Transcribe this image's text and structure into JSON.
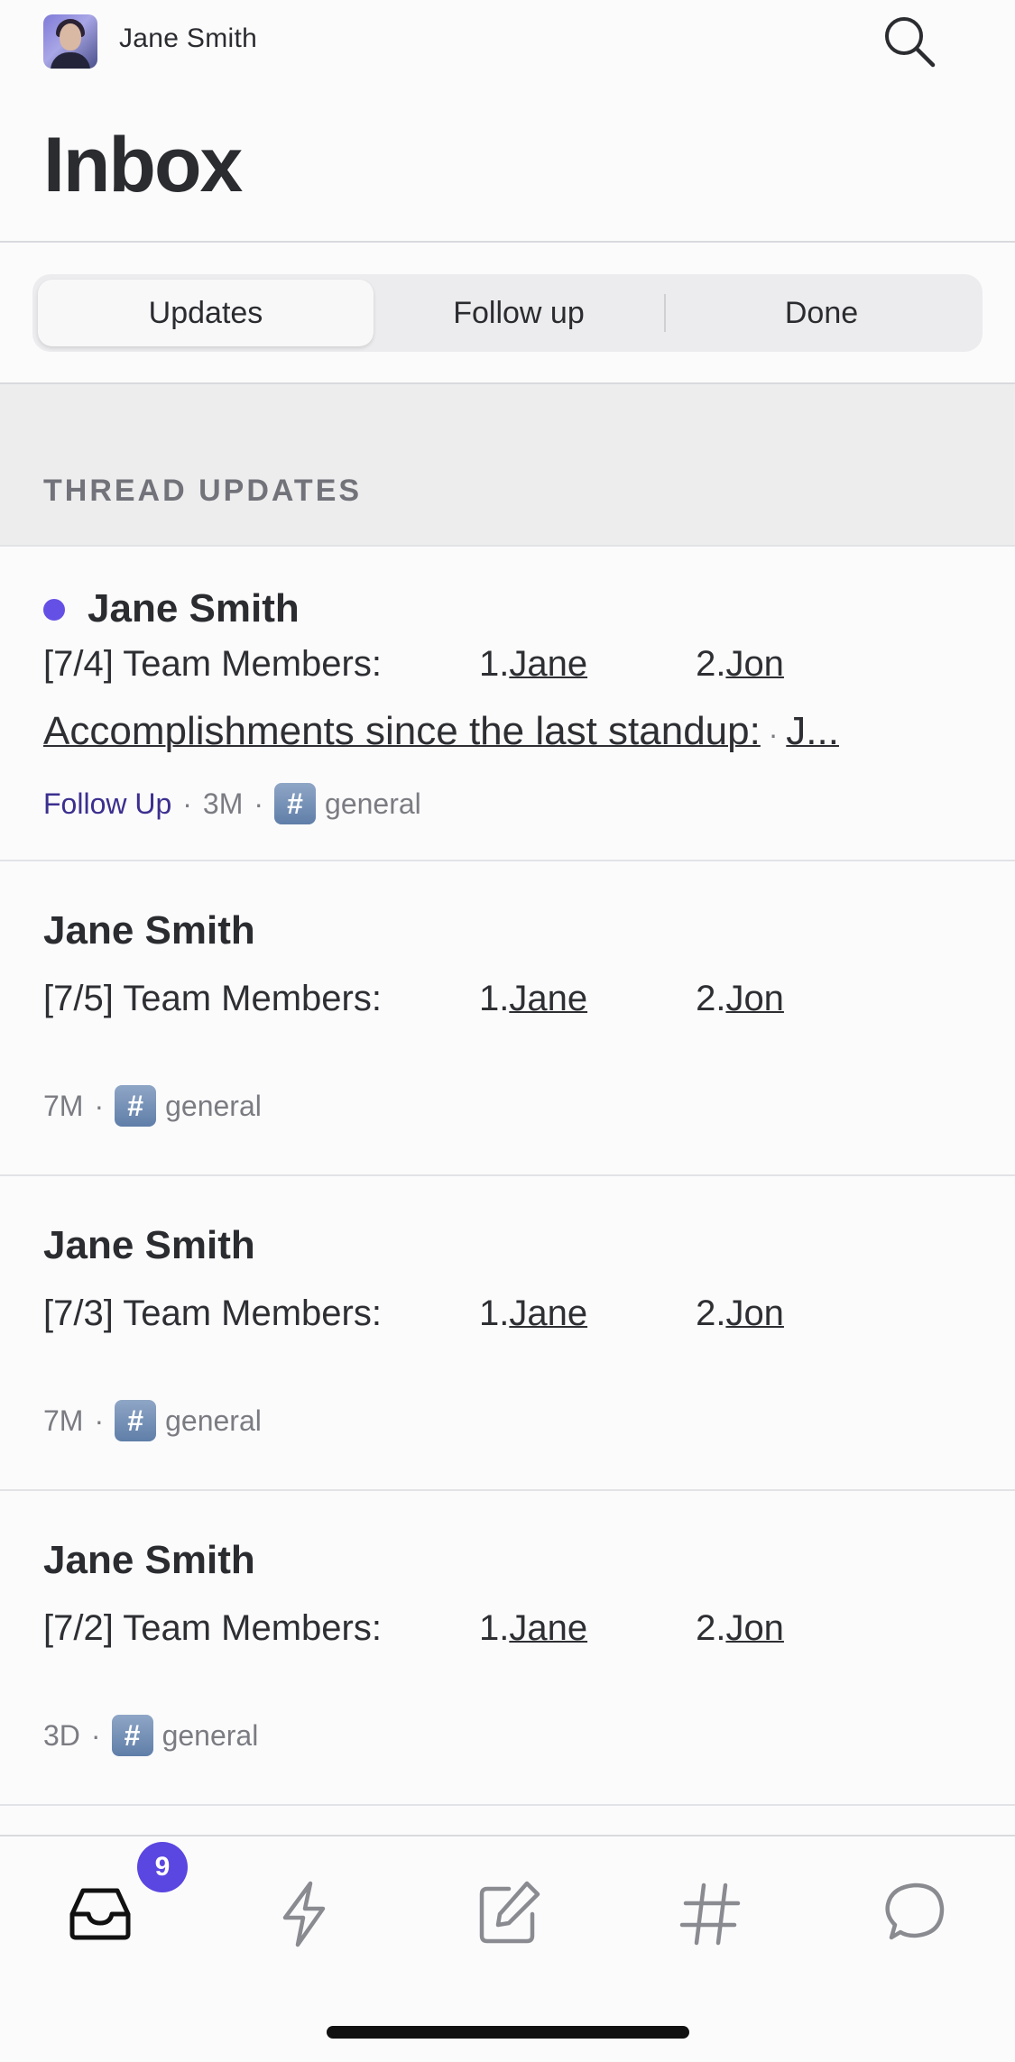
{
  "header": {
    "user_name": "Jane Smith",
    "title": "Inbox"
  },
  "tabs": [
    {
      "label": "Updates",
      "active": true
    },
    {
      "label": "Follow up",
      "active": false
    },
    {
      "label": "Done",
      "active": false
    }
  ],
  "section": {
    "title": "THREAD UPDATES"
  },
  "items": [
    {
      "unread": true,
      "sender": "Jane Smith",
      "line1": {
        "prefix": "[7/4] Team Members:",
        "n1": "1.",
        "name1": "Jane",
        "n2": "2.",
        "name2": "Jon"
      },
      "line2": {
        "text": "Accomplishments since the last standup:",
        "sep": " · ",
        "tail": "J..."
      },
      "meta": {
        "followup": "Follow Up",
        "time": "3M",
        "channel": "general"
      }
    },
    {
      "unread": false,
      "sender": "Jane Smith",
      "line1": {
        "prefix": "[7/5] Team Members:",
        "n1": "1.",
        "name1": "Jane",
        "n2": "2.",
        "name2": "Jon"
      },
      "meta": {
        "time": "7M",
        "channel": "general"
      }
    },
    {
      "unread": false,
      "sender": "Jane Smith",
      "line1": {
        "prefix": "[7/3] Team Members:",
        "n1": "1.",
        "name1": "Jane",
        "n2": "2.",
        "name2": "Jon"
      },
      "meta": {
        "time": "7M",
        "channel": "general"
      }
    },
    {
      "unread": false,
      "sender": "Jane Smith",
      "line1": {
        "prefix": "[7/2] Team Members:",
        "n1": "1.",
        "name1": "Jane",
        "n2": "2.",
        "name2": "Jon"
      },
      "meta": {
        "time": "3D",
        "channel": "general"
      }
    }
  ],
  "meta_separator": "·",
  "channel_hash": "#",
  "bottom_nav": {
    "inbox_badge": "9",
    "items": [
      "inbox-icon",
      "lightning-icon",
      "compose-icon",
      "hash-icon",
      "chat-bubble-icon"
    ]
  },
  "colors": {
    "accent": "#5a46e0",
    "unread_dot": "#6550e6",
    "followup_text": "#3b2f8f"
  }
}
